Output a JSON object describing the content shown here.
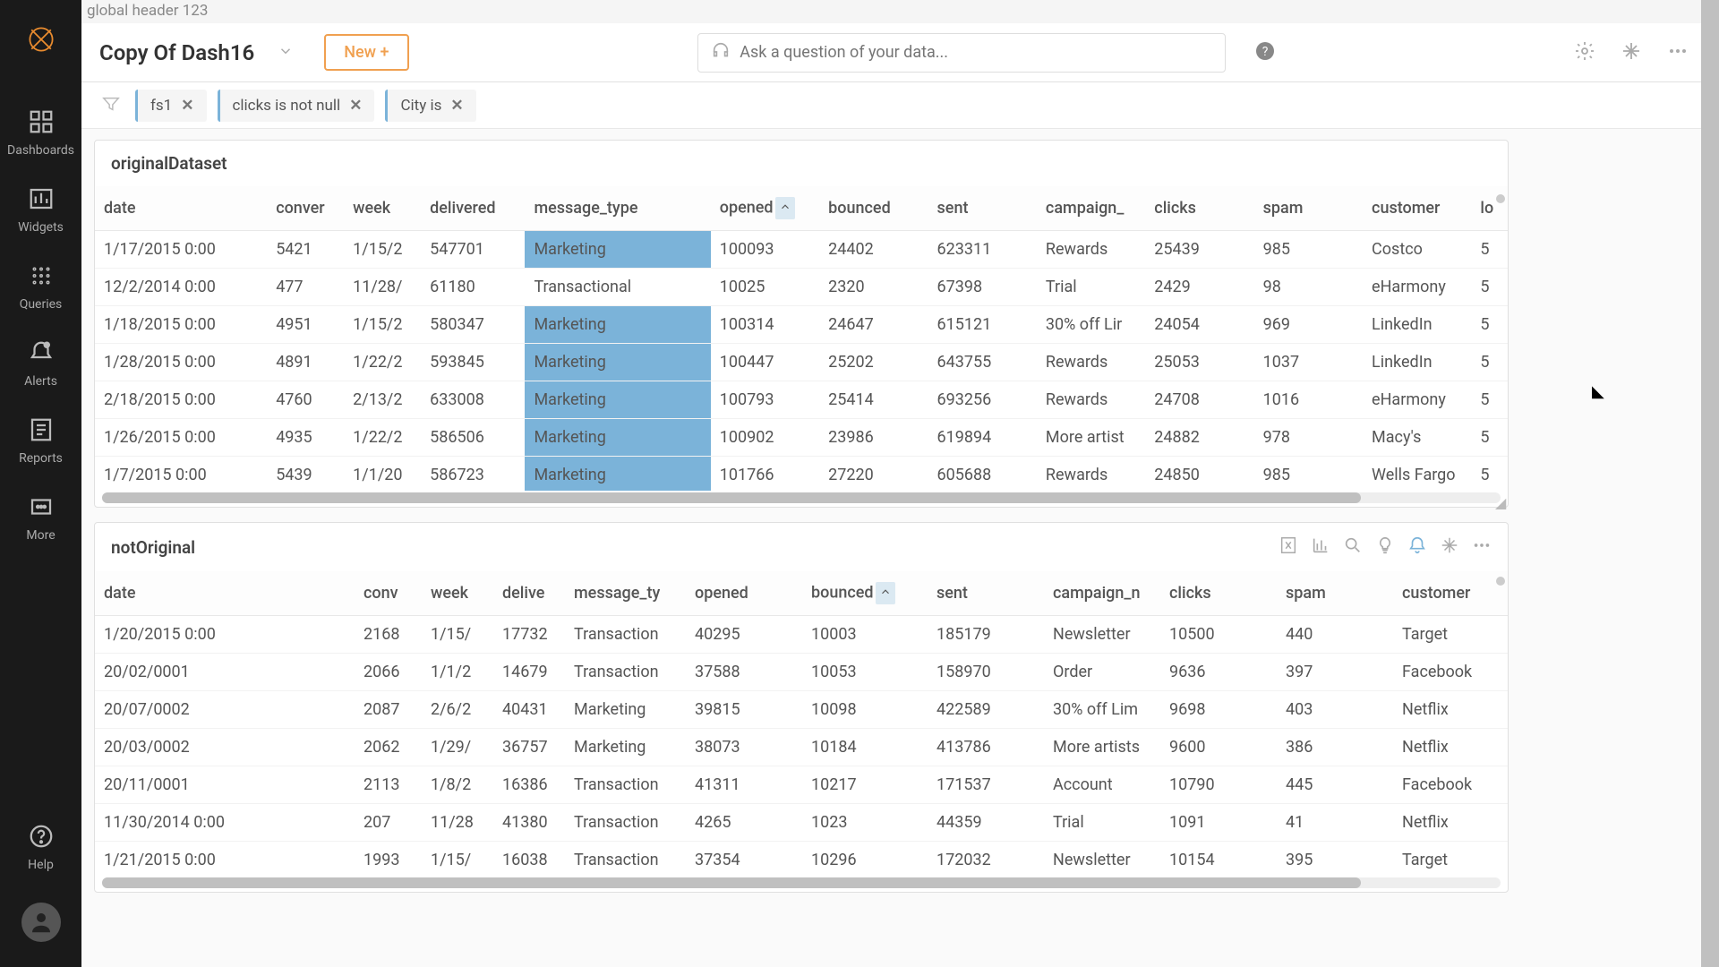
{
  "global_header": "global header 123",
  "dashboard_title": "Copy Of Dash16",
  "new_button": "New +",
  "search_placeholder": "Ask a question of your data...",
  "sidebar": {
    "items": [
      {
        "label": "Dashboards"
      },
      {
        "label": "Widgets"
      },
      {
        "label": "Queries"
      },
      {
        "label": "Alerts"
      },
      {
        "label": "Reports"
      },
      {
        "label": "More"
      }
    ],
    "help": "Help"
  },
  "filters": [
    {
      "label": "fs1"
    },
    {
      "label": "clicks is not null"
    },
    {
      "label": "City is"
    }
  ],
  "widget1": {
    "title": "originalDataset",
    "columns": [
      "date",
      "conver",
      "week",
      "delivered",
      "message_type",
      "opened",
      "bounced",
      "sent",
      "campaign_",
      "clicks",
      "spam",
      "customer",
      "lo"
    ],
    "sorted_col": "opened",
    "rows": [
      {
        "date": "1/17/2015 0:00",
        "conv": "5421",
        "week": "1/15/2",
        "delivered": "547701",
        "msg": "Marketing",
        "opened": "100093",
        "bounced": "24402",
        "sent": "623311",
        "camp": "Rewards",
        "clicks": "25439",
        "spam": "985",
        "cust": "Costco",
        "lo": "5",
        "hl": true
      },
      {
        "date": "12/2/2014 0:00",
        "conv": "477",
        "week": "11/28/",
        "delivered": "61180",
        "msg": "Transactional",
        "opened": "10025",
        "bounced": "2320",
        "sent": "67398",
        "camp": "Trial",
        "clicks": "2429",
        "spam": "98",
        "cust": "eHarmony",
        "lo": "5",
        "hl": false
      },
      {
        "date": "1/18/2015 0:00",
        "conv": "4951",
        "week": "1/15/2",
        "delivered": "580347",
        "msg": "Marketing",
        "opened": "100314",
        "bounced": "24647",
        "sent": "615121",
        "camp": "30% off Lir",
        "clicks": "24054",
        "spam": "969",
        "cust": "LinkedIn",
        "lo": "5",
        "hl": true
      },
      {
        "date": "1/28/2015 0:00",
        "conv": "4891",
        "week": "1/22/2",
        "delivered": "593845",
        "msg": "Marketing",
        "opened": "100447",
        "bounced": "25202",
        "sent": "643755",
        "camp": "Rewards",
        "clicks": "25053",
        "spam": "1037",
        "cust": "LinkedIn",
        "lo": "5",
        "hl": true
      },
      {
        "date": "2/18/2015 0:00",
        "conv": "4760",
        "week": "2/13/2",
        "delivered": "633008",
        "msg": "Marketing",
        "opened": "100793",
        "bounced": "25414",
        "sent": "693256",
        "camp": "Rewards",
        "clicks": "24708",
        "spam": "1016",
        "cust": "eHarmony",
        "lo": "5",
        "hl": true
      },
      {
        "date": "1/26/2015 0:00",
        "conv": "4935",
        "week": "1/22/2",
        "delivered": "586506",
        "msg": "Marketing",
        "opened": "100902",
        "bounced": "23986",
        "sent": "619894",
        "camp": "More artist",
        "clicks": "24882",
        "spam": "978",
        "cust": "Macy's",
        "lo": "5",
        "hl": true
      },
      {
        "date": "1/7/2015 0:00",
        "conv": "5439",
        "week": "1/1/20",
        "delivered": "586723",
        "msg": "Marketing",
        "opened": "101766",
        "bounced": "27220",
        "sent": "605688",
        "camp": "Rewards",
        "clicks": "24850",
        "spam": "985",
        "cust": "Wells Fargo",
        "lo": "5",
        "hl": true
      }
    ]
  },
  "widget2": {
    "title": "notOriginal",
    "columns": [
      "date",
      "conv",
      "week",
      "delive",
      "message_ty",
      "opened",
      "bounced",
      "sent",
      "campaign_n",
      "clicks",
      "spam",
      "customer"
    ],
    "sorted_col": "bounced",
    "rows": [
      {
        "date": "1/20/2015 0:00",
        "conv": "2168",
        "week": "1/15/",
        "deliv": "17732",
        "msg": "Transaction",
        "opened": "40295",
        "bounced": "10003",
        "sent": "185179",
        "camp": "Newsletter",
        "clicks": "10500",
        "spam": "440",
        "cust": "Target"
      },
      {
        "date": "20/02/0001",
        "conv": "2066",
        "week": "1/1/2",
        "deliv": "14679",
        "msg": "Transaction",
        "opened": "37588",
        "bounced": "10053",
        "sent": "158970",
        "camp": "Order",
        "clicks": "9636",
        "spam": "397",
        "cust": "Facebook"
      },
      {
        "date": "20/07/0002",
        "conv": "2087",
        "week": "2/6/2",
        "deliv": "40431",
        "msg": "Marketing",
        "opened": "39815",
        "bounced": "10098",
        "sent": "422589",
        "camp": "30% off Lim",
        "clicks": "9698",
        "spam": "403",
        "cust": "Netflix"
      },
      {
        "date": "20/03/0002",
        "conv": "2062",
        "week": "1/29/",
        "deliv": "36757",
        "msg": "Marketing",
        "opened": "38073",
        "bounced": "10184",
        "sent": "413786",
        "camp": "More artists",
        "clicks": "9600",
        "spam": "386",
        "cust": "Netflix"
      },
      {
        "date": "20/11/0001",
        "conv": "2113",
        "week": "1/8/2",
        "deliv": "16386",
        "msg": "Transaction",
        "opened": "41311",
        "bounced": "10217",
        "sent": "171537",
        "camp": "Account",
        "clicks": "10790",
        "spam": "445",
        "cust": "Facebook"
      },
      {
        "date": "11/30/2014 0:00",
        "conv": "207",
        "week": "11/28",
        "deliv": "41380",
        "msg": "Transaction",
        "opened": "4265",
        "bounced": "1023",
        "sent": "44359",
        "camp": "Trial",
        "clicks": "1091",
        "spam": "41",
        "cust": "Netflix"
      },
      {
        "date": "1/21/2015 0:00",
        "conv": "1993",
        "week": "1/15/",
        "deliv": "16038",
        "msg": "Transaction",
        "opened": "37354",
        "bounced": "10296",
        "sent": "172032",
        "camp": "Newsletter",
        "clicks": "10154",
        "spam": "395",
        "cust": "Target"
      }
    ]
  }
}
